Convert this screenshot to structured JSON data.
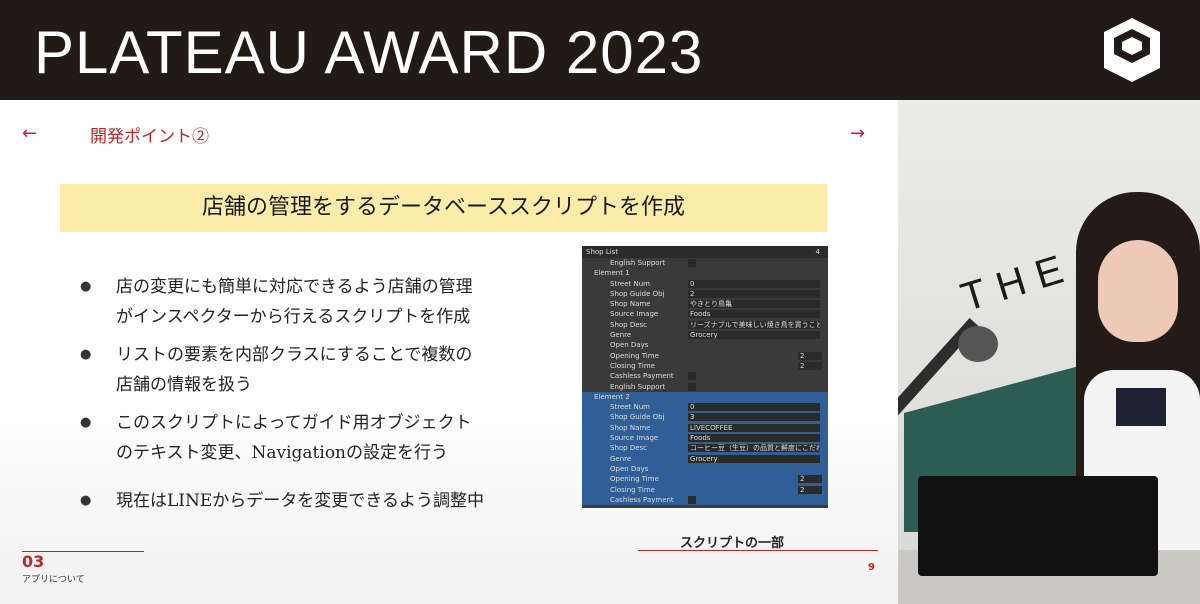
{
  "header": {
    "title": "PLATEAU AWARD 2023",
    "logo": "plateau-logo-icon"
  },
  "slide": {
    "nav_left": "←",
    "nav_right": "→",
    "subtitle": "開発ポイント②",
    "banner": "店舗の管理をするデータベーススクリプトを作成",
    "bullets": [
      [
        "店の変更にも簡単に対応できるよう店舗の管理",
        "がインスペクターから行えるスクリプトを作成"
      ],
      [
        "リストの要素を内部クラスにすることで複数の",
        "店舗の情報を扱う"
      ],
      [
        "このスクリプトによってガイド用オブジェクト",
        "のテキスト変更、Navigationの設定を行う"
      ],
      [
        "現在はLINEからデータを変更できるよう調整中"
      ]
    ],
    "caption": "スクリプトの一部",
    "section_number": "03",
    "section_label": "アプリについて",
    "page_number": "9"
  },
  "inspector": {
    "title": "Shop List",
    "count": "4",
    "top_row": "English Support",
    "element1": {
      "label": "Element 1",
      "street_num_label": "Street Num",
      "street_num": "0",
      "guide_obj_label": "Shop Guide Obj",
      "guide_obj": "2",
      "shop_name_label": "Shop Name",
      "shop_name": "やきとり鳥亀",
      "source_image_label": "Source Image",
      "source_image": "Foods",
      "shop_desc_label": "Shop Desc",
      "shop_desc": "リーズナブルで美味しい焼き鳥を買うことがで",
      "genre_label": "Genre",
      "genre": "Grocery",
      "open_days_label": "Open Days",
      "opening_time_label": "Opening Time",
      "opening_time": "2",
      "closing_time_label": "Closing Time",
      "closing_time": "2",
      "cashless_label": "Cashless Payment",
      "english_label": "English Support"
    },
    "element2": {
      "label": "Element 2",
      "street_num_label": "Street Num",
      "street_num": "0",
      "guide_obj_label": "Shop Guide Obj",
      "guide_obj": "3",
      "shop_name_label": "Shop Name",
      "shop_name": "LIVECOFFEE",
      "source_image_label": "Source Image",
      "source_image": "Foods",
      "shop_desc_label": "Shop Desc",
      "shop_desc": "コーヒー豆（生豆）の品質と鮮度にこだわった",
      "genre_label": "Genre",
      "genre": "Grocery",
      "open_days_label": "Open Days",
      "opening_time_label": "Opening Time",
      "opening_time": "2",
      "closing_time_label": "Closing Time",
      "closing_time": "2",
      "cashless_label": "Cashless Payment"
    }
  },
  "video": {
    "wall_text": "THE NE"
  }
}
